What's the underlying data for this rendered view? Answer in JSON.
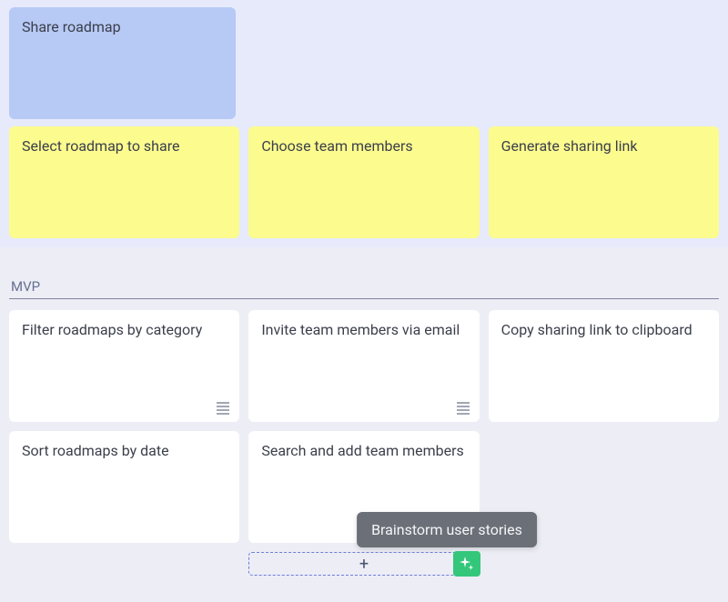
{
  "colors": {
    "parent_bg": "#B7C9F5",
    "yellow_bg": "#FCFB8E",
    "accent_green": "#34C77B",
    "dashed_border": "#6D7FD6"
  },
  "parent_card": {
    "title": "Share roadmap"
  },
  "yellow_cards": [
    {
      "title": "Select roadmap to share"
    },
    {
      "title": "Choose team members"
    },
    {
      "title": "Generate sharing link"
    }
  ],
  "section": {
    "label": "MVP"
  },
  "white_cards": [
    {
      "title": "Filter roadmaps by category",
      "has_detail": true
    },
    {
      "title": "Invite team members via email",
      "has_detail": true
    },
    {
      "title": "Copy sharing link to clipboard",
      "has_detail": false
    },
    {
      "title": "Sort roadmaps by date",
      "has_detail": false
    },
    {
      "title": "Search and add team members",
      "has_detail": false
    }
  ],
  "add": {
    "plus": "+",
    "tooltip": "Brainstorm user stories"
  }
}
